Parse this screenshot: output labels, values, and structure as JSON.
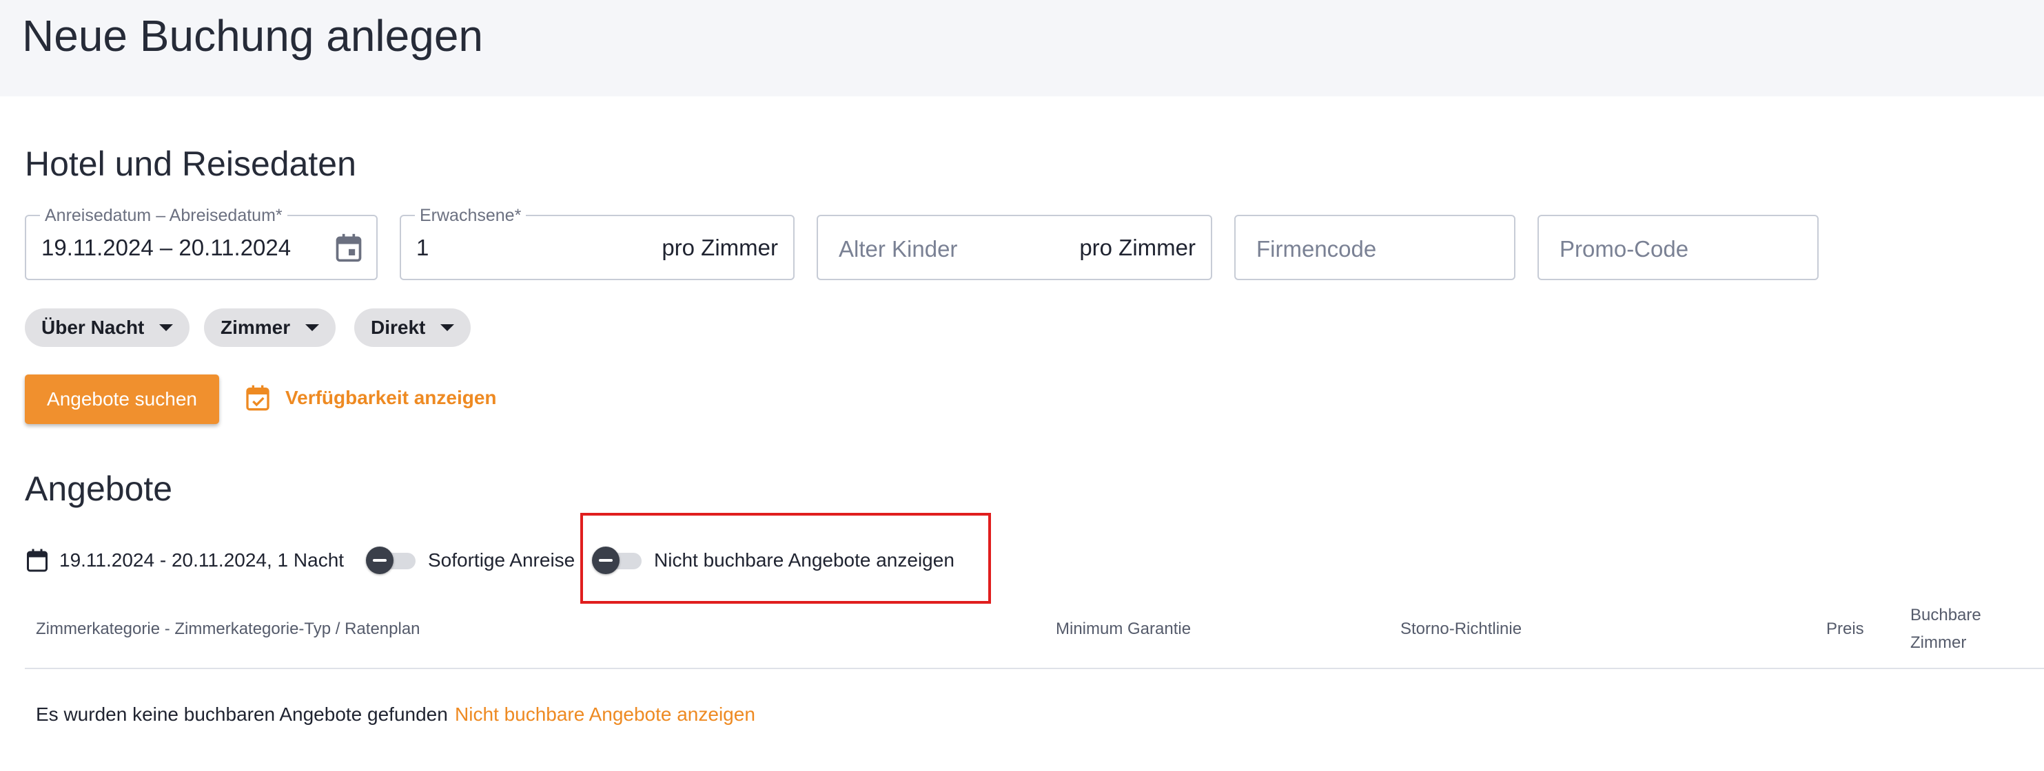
{
  "page": {
    "title": "Neue Buchung anlegen"
  },
  "hotel_section": {
    "title": "Hotel und Reisedaten",
    "date_field": {
      "label": "Anreisedatum – Abreisedatum*",
      "value": "19.11.2024 – 20.11.2024",
      "icon": "calendar-icon"
    },
    "adults_field": {
      "label": "Erwachsene*",
      "value": "1",
      "suffix": "pro Zimmer"
    },
    "children_field": {
      "placeholder": "Alter Kinder",
      "suffix": "pro Zimmer"
    },
    "company_code_field": {
      "placeholder": "Firmencode"
    },
    "promo_code_field": {
      "placeholder": "Promo-Code"
    },
    "chips": [
      {
        "label": "Über Nacht"
      },
      {
        "label": "Zimmer"
      },
      {
        "label": "Direkt"
      }
    ],
    "search_button": "Angebote suchen",
    "availability_link": "Verfügbarkeit anzeigen"
  },
  "offers_section": {
    "title": "Angebote",
    "date_summary": "19.11.2024 - 20.11.2024, 1 Nacht",
    "toggle_immediate": {
      "label": "Sofortige Anreise",
      "checked": false
    },
    "toggle_unbookable": {
      "label": "Nicht buchbare Angebote anzeigen",
      "checked": false
    },
    "table": {
      "columns": {
        "category": "Zimmerkategorie - Zimmerkategorie-Typ / Ratenplan",
        "guarantee": "Minimum Garantie",
        "cancellation": "Storno-Richtlinie",
        "price": "Preis",
        "bookable_line1": "Buchbare",
        "bookable_line2": "Zimmer"
      },
      "empty_message": "Es wurden keine buchbaren Angebote gefunden",
      "empty_link": "Nicht buchbare Angebote anzeigen"
    }
  },
  "colors": {
    "accent": "#f0902e",
    "highlight": "#e01e1e",
    "header_bg": "#f5f6f9"
  }
}
